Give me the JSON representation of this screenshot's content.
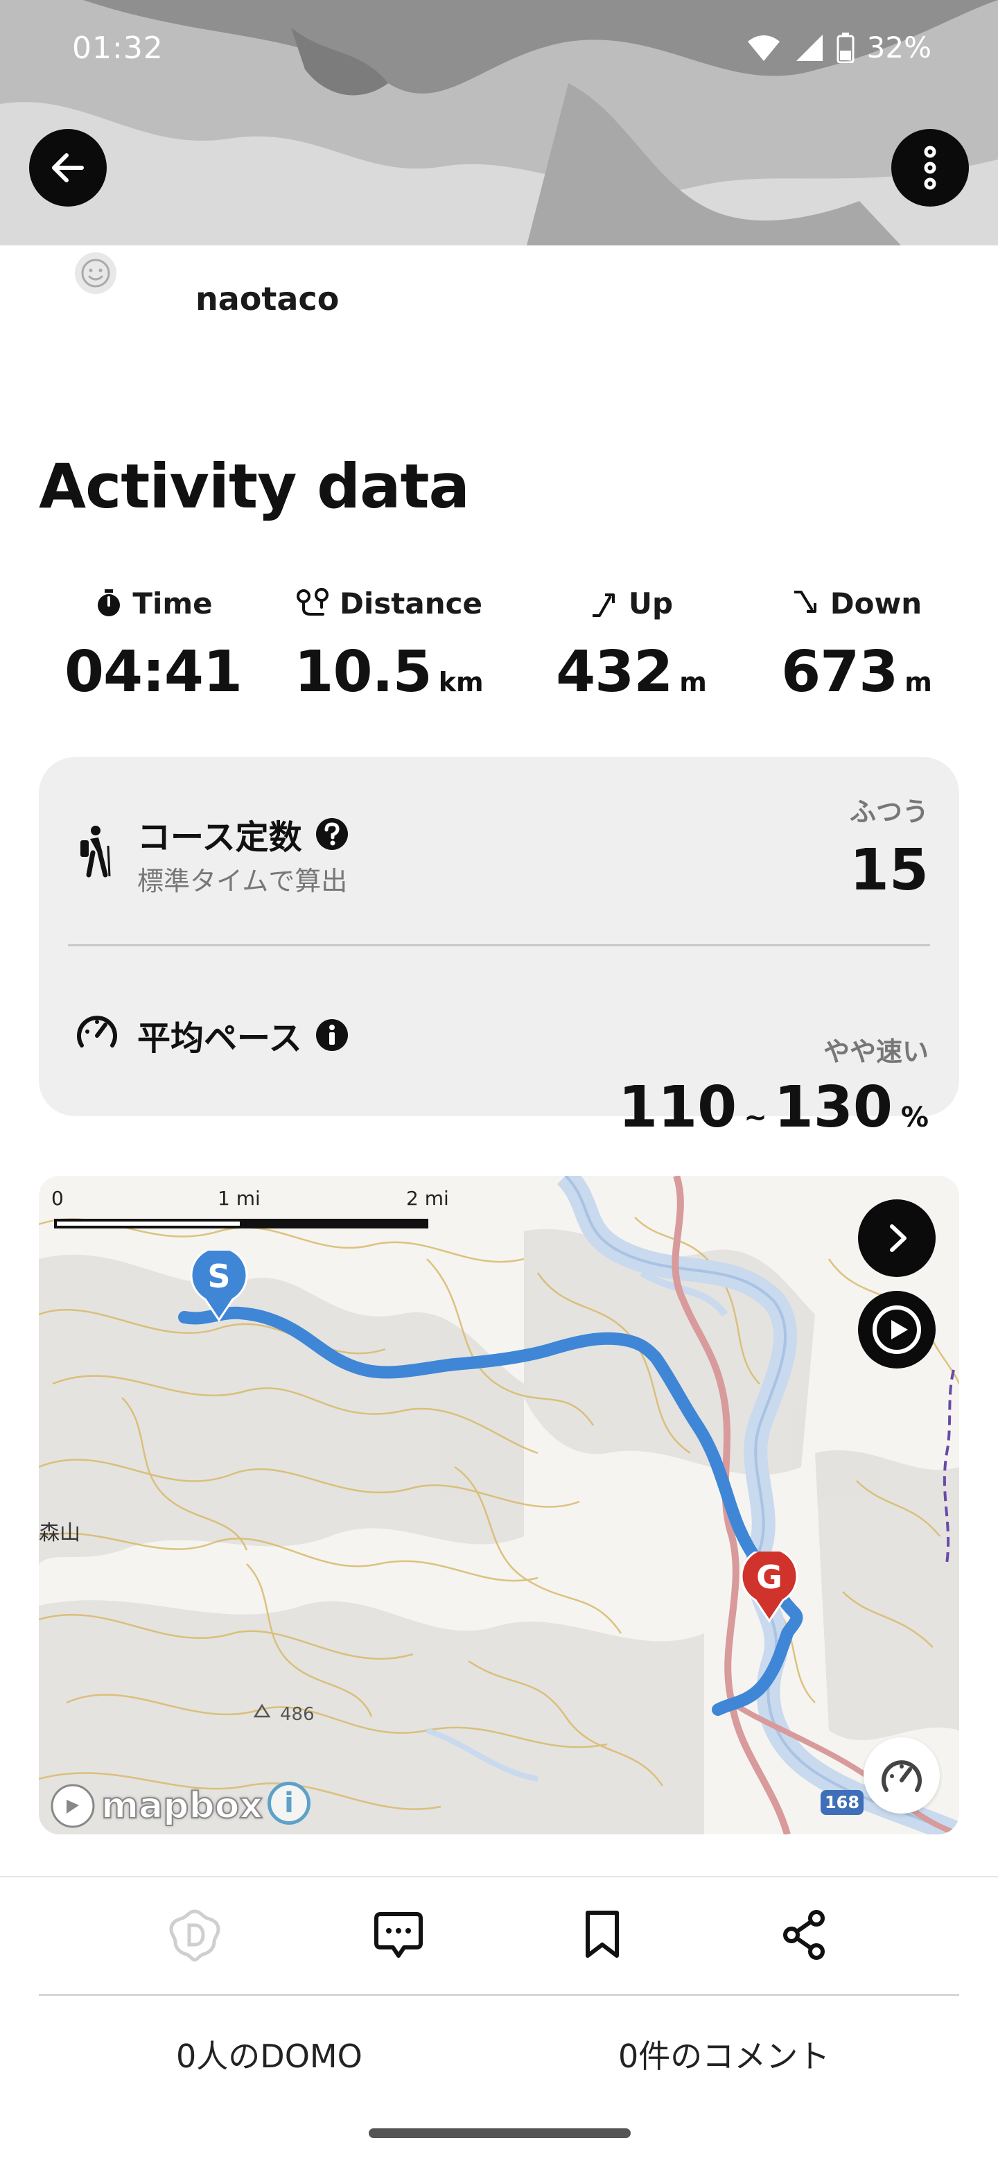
{
  "status_bar": {
    "time": "01:32",
    "battery": "32%",
    "icons": [
      "wifi-icon",
      "signal-icon",
      "battery-icon"
    ]
  },
  "header": {
    "back_icon": "arrow-left-icon",
    "more_icon": "more-vertical-icon"
  },
  "user": {
    "avatar_icon": "smiley-icon",
    "name": "naotaco"
  },
  "activity": {
    "title": "Activity data",
    "stats": [
      {
        "icon": "stopwatch-icon",
        "label": "Time",
        "value": "04:41",
        "unit": ""
      },
      {
        "icon": "route-pins-icon",
        "label": "Distance",
        "value": "10.5",
        "unit": "km"
      },
      {
        "icon": "ascent-icon",
        "label": "Up",
        "value": "432",
        "unit": "m"
      },
      {
        "icon": "descent-icon",
        "label": "Down",
        "value": "673",
        "unit": "m"
      }
    ]
  },
  "course": {
    "constant": {
      "icon": "hiker-icon",
      "title": "コース定数",
      "help_icon": "question-circle-icon",
      "subtitle": "標準タイムで算出",
      "rank": "ふつう",
      "value": "15"
    },
    "pace": {
      "icon": "speedometer-icon",
      "title": "平均ペース",
      "info_icon": "info-circle-icon",
      "rank": "やや速い",
      "min": "110",
      "separator": "~",
      "max": "130",
      "unit": "%"
    }
  },
  "map": {
    "scale_labels": [
      "0",
      "1 mi",
      "2 mi"
    ],
    "start_marker": "S",
    "goal_marker": "G",
    "place_name": "森山",
    "peak_label": "486",
    "road_number": "168",
    "attribution": "mapbox",
    "attribution_info": "i",
    "route_color": "#3f86d6",
    "next_icon": "chevron-right-icon",
    "play_icon": "play-circle-icon",
    "speed_icon": "speedometer-icon"
  },
  "actions": {
    "domo_icon": "domo-icon",
    "comment_icon": "comment-icon",
    "bookmark_icon": "bookmark-icon",
    "share_icon": "share-icon",
    "domo_count": "0人のDOMO",
    "comment_count": "0件のコメント"
  }
}
